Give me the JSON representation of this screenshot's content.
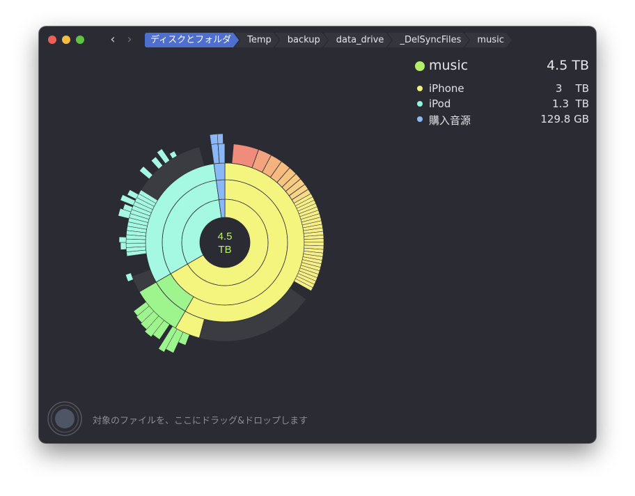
{
  "window": {
    "breadcrumbs": [
      "ディスクとフォルダ",
      "Temp",
      "backup",
      "data_drive",
      "_DelSyncFiles",
      "music"
    ],
    "active_crumb": 0
  },
  "center": {
    "size_value": "4.5",
    "size_unit": "TB",
    "color": "#b9f06a"
  },
  "legend": {
    "title": "music",
    "title_size": "4.5 TB",
    "title_color": "#b4ef6c",
    "items": [
      {
        "name": "iPhone",
        "size": "3    TB",
        "color": "#eef27a"
      },
      {
        "name": "iPod",
        "size": "1.3  TB",
        "color": "#8ff5df"
      },
      {
        "name": "購入音源",
        "size": "129.8 GB",
        "color": "#8db8f5"
      }
    ]
  },
  "drop_hint": "対象のファイルを、ここにドラッグ&ドロップします",
  "colors": {
    "background": "#2b2c33",
    "accent": "#4f6fcf",
    "iphone": "#f4f57e",
    "ipod": "#a5f8e1",
    "purchased": "#8ab8f7",
    "warm": "#ef8f7a",
    "green": "#9ef58e",
    "gray": "#3b3c42"
  }
}
